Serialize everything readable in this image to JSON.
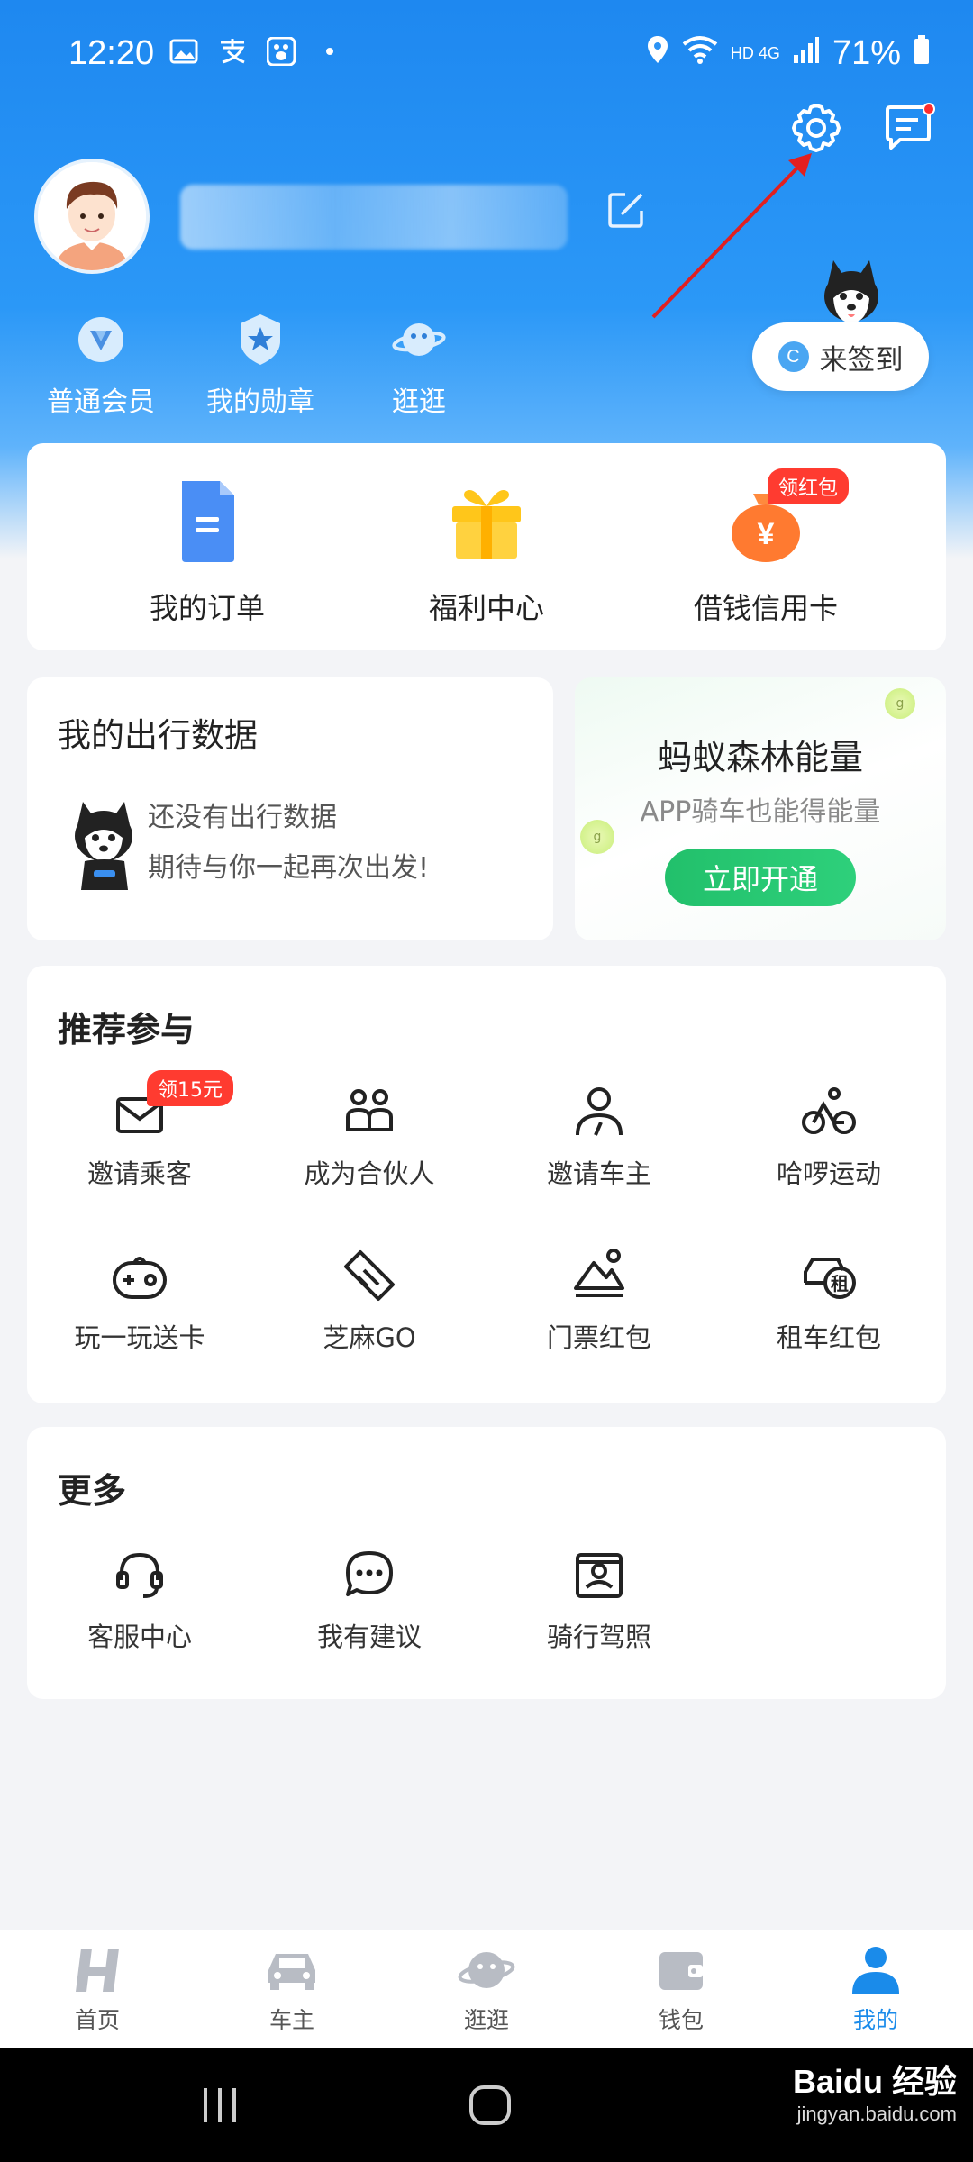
{
  "status_bar": {
    "time": "12:20",
    "network": "HD 4G",
    "battery": "71%"
  },
  "profile": {
    "username_masked": ""
  },
  "quick_links": [
    {
      "label": "普通会员",
      "icon": "member-icon"
    },
    {
      "label": "我的勋章",
      "icon": "medal-icon"
    },
    {
      "label": "逛逛",
      "icon": "planet-icon"
    }
  ],
  "signin": {
    "label": "来签到",
    "coin": "C"
  },
  "main_services": [
    {
      "label": "我的订单",
      "icon": "order-icon"
    },
    {
      "label": "福利中心",
      "icon": "gift-icon"
    },
    {
      "label": "借钱信用卡",
      "icon": "money-bag-icon",
      "badge": "领红包"
    }
  ],
  "travel": {
    "title": "我的出行数据",
    "line1": "还没有出行数据",
    "line2": "期待与你一起再次出发!"
  },
  "forest": {
    "title": "蚂蚁森林能量",
    "subtitle": "APP骑车也能得能量",
    "button": "立即开通"
  },
  "recommend": {
    "title": "推荐参与",
    "items": [
      {
        "label": "邀请乘客",
        "icon": "envelope-icon",
        "badge": "领15元"
      },
      {
        "label": "成为合伙人",
        "icon": "partners-icon"
      },
      {
        "label": "邀请车主",
        "icon": "driver-icon"
      },
      {
        "label": "哈啰运动",
        "icon": "bicycle-icon"
      },
      {
        "label": "玩一玩送卡",
        "icon": "gamepad-icon"
      },
      {
        "label": "芝麻GO",
        "icon": "ticket-icon"
      },
      {
        "label": "门票红包",
        "icon": "scenery-icon"
      },
      {
        "label": "租车红包",
        "icon": "rent-car-icon",
        "icon_text": "租"
      }
    ]
  },
  "more": {
    "title": "更多",
    "items": [
      {
        "label": "客服中心",
        "icon": "headset-icon"
      },
      {
        "label": "我有建议",
        "icon": "chat-bubble-icon"
      },
      {
        "label": "骑行驾照",
        "icon": "license-icon"
      }
    ]
  },
  "tabbar": {
    "items": [
      {
        "label": "首页",
        "icon": "home-h-icon"
      },
      {
        "label": "车主",
        "icon": "car-icon"
      },
      {
        "label": "逛逛",
        "icon": "planet-icon"
      },
      {
        "label": "钱包",
        "icon": "wallet-icon"
      },
      {
        "label": "我的",
        "icon": "person-icon",
        "active": true
      }
    ]
  },
  "watermark": {
    "brand": "Baidu 经验",
    "url": "jingyan.baidu.com"
  },
  "colors": {
    "primary": "#1e88f0",
    "accent_green": "#22c06b",
    "badge_red": "#ff3b30",
    "active_tab": "#1a8bea"
  }
}
